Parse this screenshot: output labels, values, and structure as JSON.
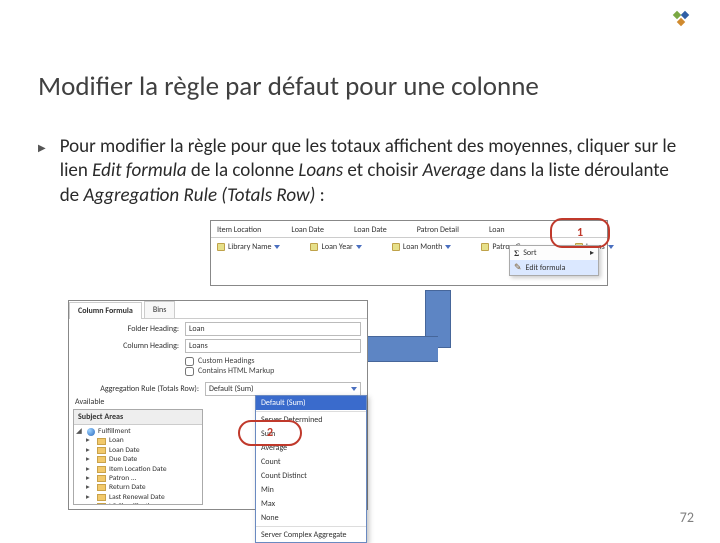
{
  "slide": {
    "title": "Modifier la règle par défaut pour une colonne",
    "bullet_pre": "Pour modifier la règle pour que les totaux affichent des moyennes, cliquer sur le lien ",
    "em1": "Edit formula",
    "bullet_mid": " de la colonne ",
    "em2": "Loans",
    "bullet_mid2": " et choisir ",
    "em3": "Average",
    "bullet_mid3": " dans la liste déroulante de ",
    "em4": "Aggregation Rule (Totals Row)",
    "bullet_end": " :",
    "page_number": "72"
  },
  "shot1": {
    "columns": [
      "Item Location",
      "Loan Date",
      "Loan Date",
      "Patron Detail",
      "Loan"
    ],
    "subs": [
      "Library Name",
      "Loan Year",
      "Loan Month",
      "Patron Group",
      "Loans"
    ],
    "popup": {
      "sort": "Sort",
      "edit": "Edit formula"
    }
  },
  "callouts": {
    "one": "1",
    "two": "2"
  },
  "shot2": {
    "tabs": [
      "Column Formula",
      "Bins"
    ],
    "folder_heading_lbl": "Folder Heading:",
    "folder_heading_val": "Loan",
    "column_heading_lbl": "Column Heading:",
    "column_heading_val": "Loans",
    "chk_custom_heading": "Custom Headings",
    "chk_markup": "Contains HTML Markup",
    "agg_lbl": "Aggregation Rule (Totals Row):",
    "agg_val": "Default (Sum)",
    "available_lbl": "Available",
    "tree_header": "Subject Areas",
    "root": "Fulfillment",
    "folders": [
      "Loan",
      "Loan Date",
      "Due Date",
      "Item Location Date",
      "Patron ...",
      "Return Date",
      "Last Renewal Date",
      "LC Classifications"
    ]
  },
  "dropdown": {
    "options": [
      "Default (Sum)",
      "Server Determined",
      "Sum",
      "Average",
      "Count",
      "Count Distinct",
      "Min",
      "Max",
      "None",
      "Server Complex Aggregate"
    ]
  }
}
